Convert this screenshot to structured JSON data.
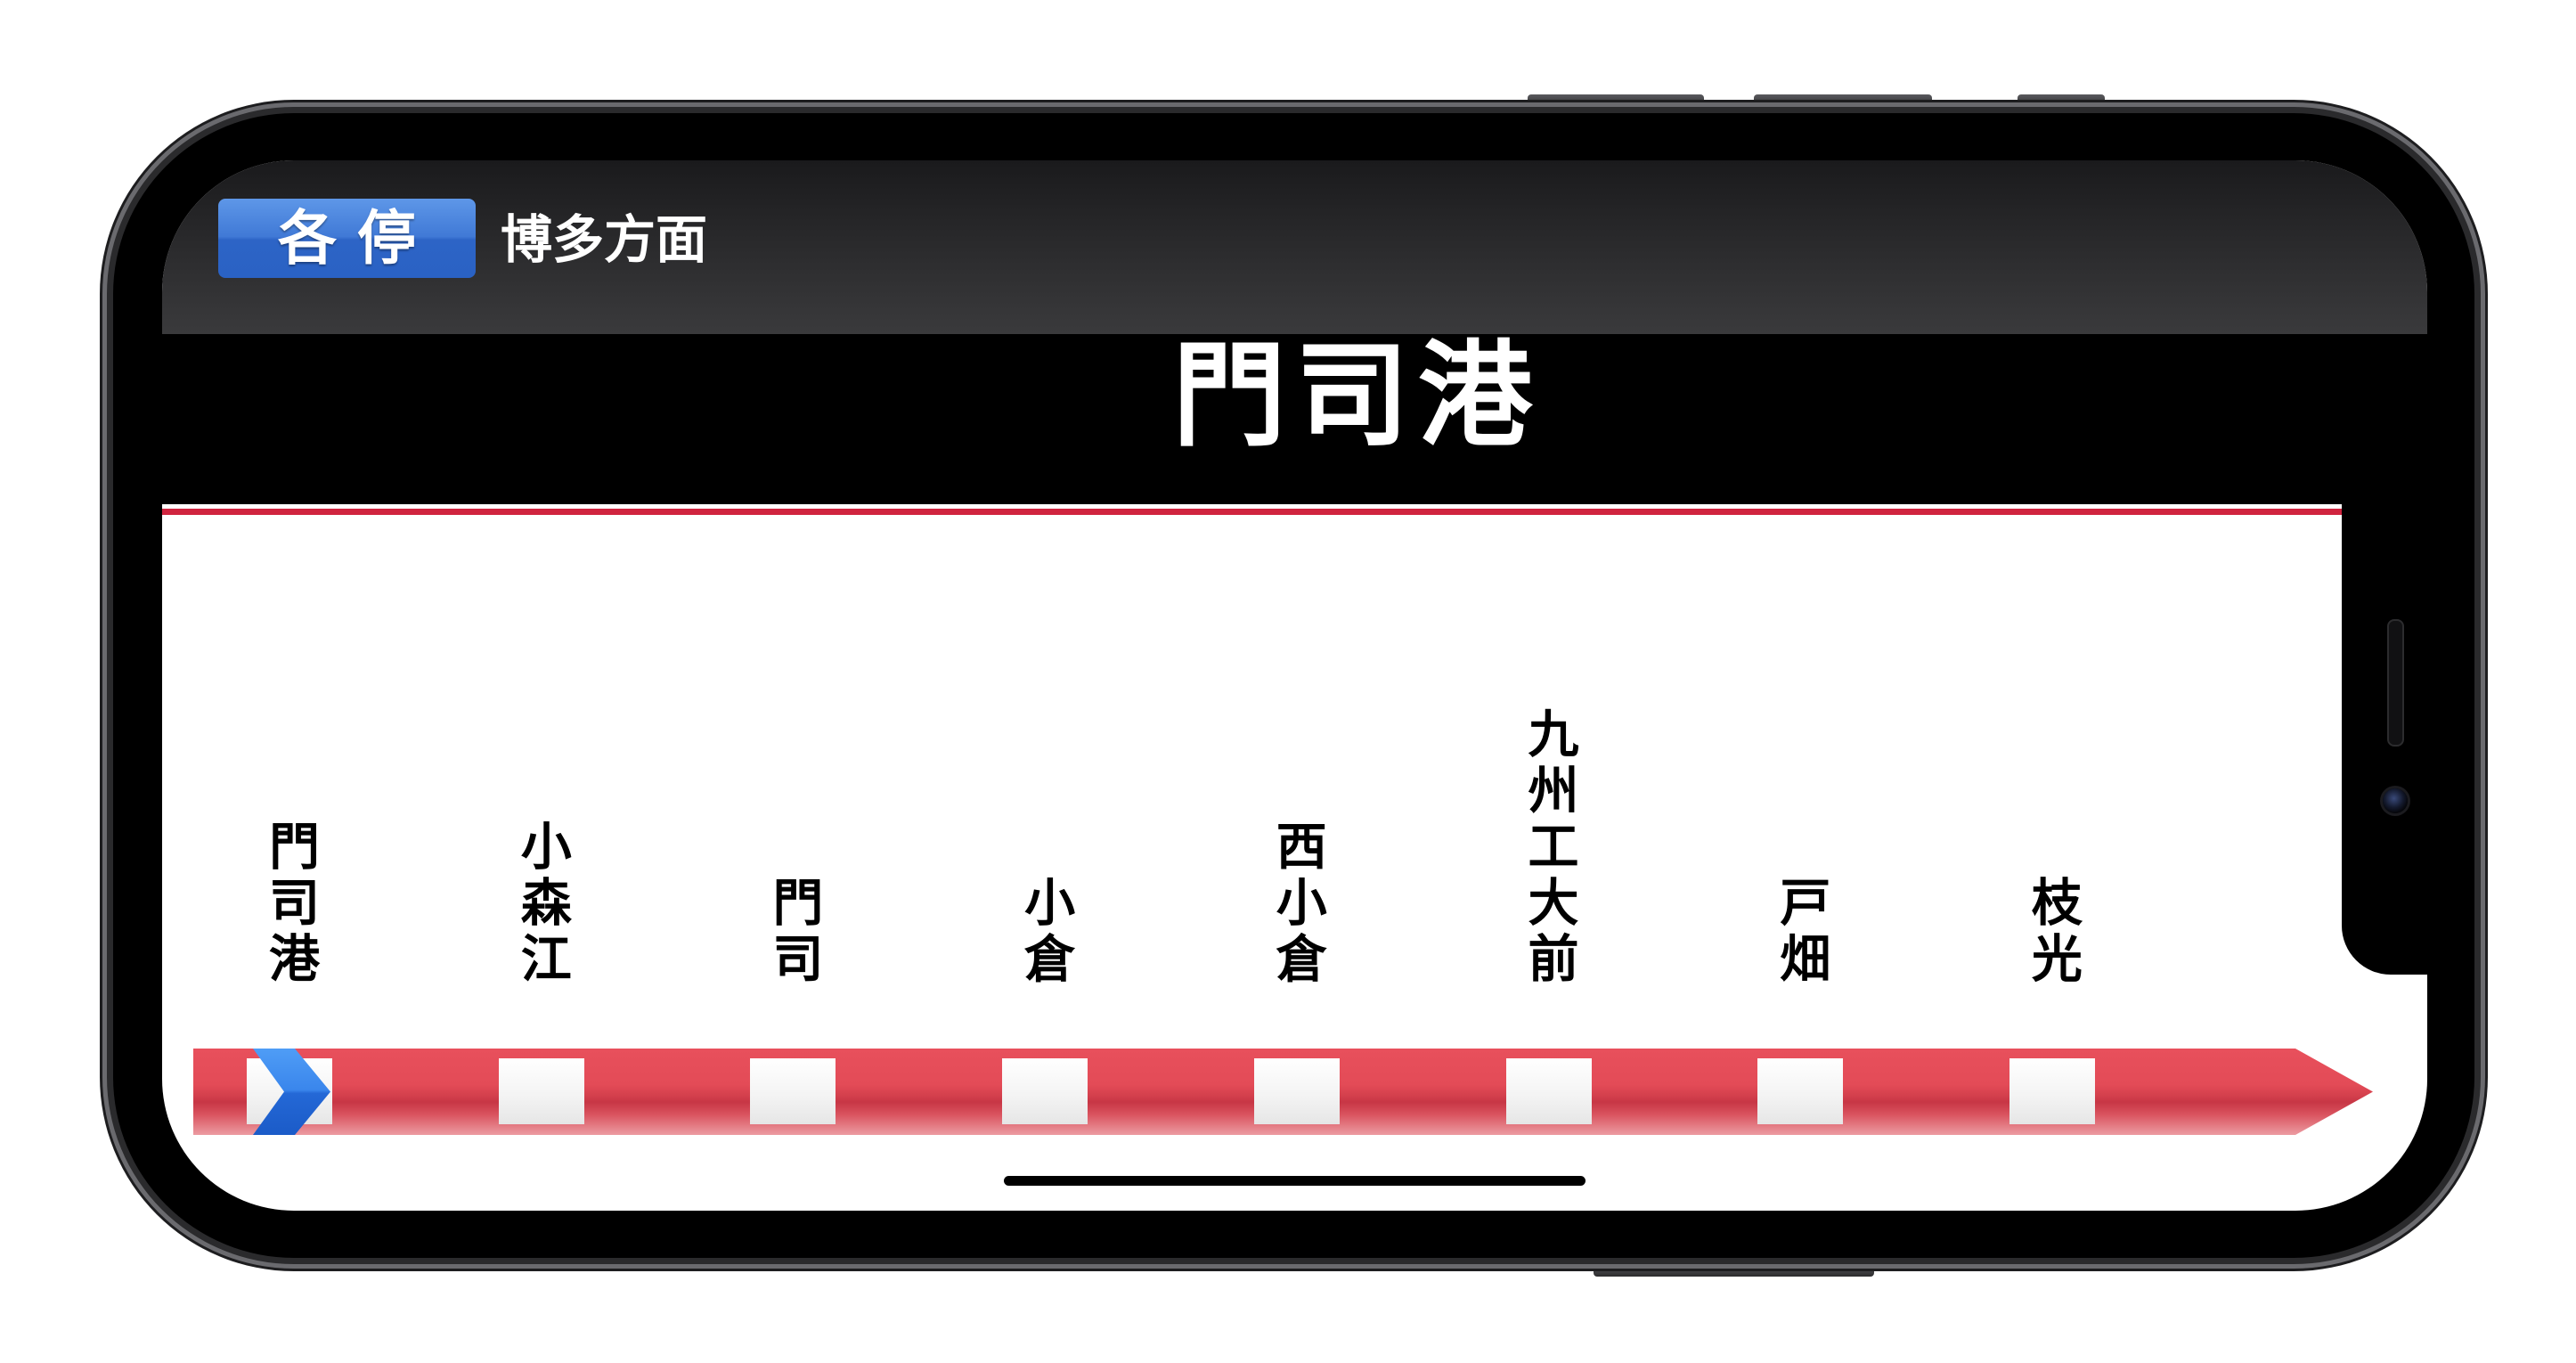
{
  "header": {
    "service_type_badge": "各 停",
    "direction_label": "博多方面"
  },
  "current_station_title": "門司港",
  "route": {
    "current_station_index": 0,
    "stations": [
      {
        "name": "門司港"
      },
      {
        "name": "小森江"
      },
      {
        "name": "門司"
      },
      {
        "name": "小倉"
      },
      {
        "name": "西小倉"
      },
      {
        "name": "九州工大前"
      },
      {
        "name": "戸畑"
      },
      {
        "name": "枝光"
      }
    ]
  },
  "colors": {
    "accent_line": "#d0243f",
    "route_line_red": "#e04a57",
    "badge_blue": "#2a62c4",
    "current_marker_blue": "#2a74e2"
  },
  "icons": {
    "current_position": "chevron-right-icon"
  }
}
